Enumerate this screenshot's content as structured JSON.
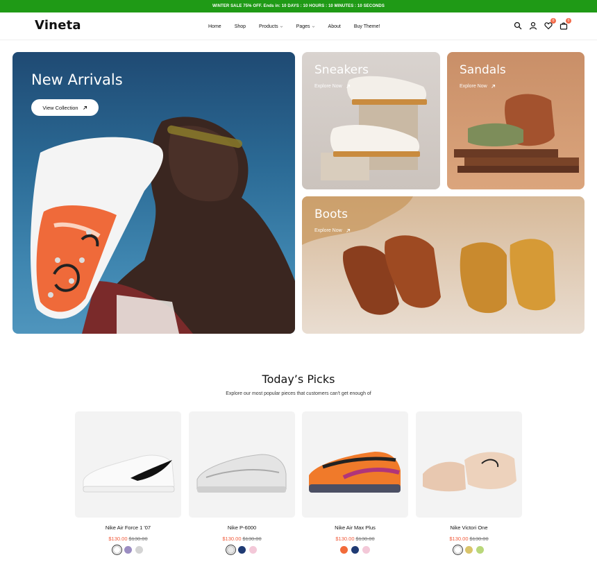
{
  "topbar": {
    "text": "WINTER SALE 75% OFF. Ends in: 10 DAYS : 10 HOURS : 10 MINUTES : 10 SECONDS"
  },
  "brand": {
    "logo": "Vineta"
  },
  "nav": [
    {
      "label": "Home"
    },
    {
      "label": "Shop"
    },
    {
      "label": "Products",
      "has_dropdown": true
    },
    {
      "label": "Pages",
      "has_dropdown": true
    },
    {
      "label": "About"
    },
    {
      "label": "Buy Theme!"
    }
  ],
  "header_icons": {
    "wishlist_count": "0",
    "cart_count": "0"
  },
  "hero": {
    "title": "New Arrivals",
    "button": "View Collection"
  },
  "collections": [
    {
      "title": "Sneakers",
      "cta": "Explore Now"
    },
    {
      "title": "Sandals",
      "cta": "Explore Now"
    },
    {
      "title": "Boots",
      "cta": "Explore Now"
    }
  ],
  "picks": {
    "title": "Today’s Picks",
    "subtitle": "Explore our most popular pieces that customers can't get enough of",
    "products": [
      {
        "name": "Nike Air Force 1 '07",
        "price": "$130.00",
        "compare_price": "$130.00",
        "swatches": [
          "#ffffff",
          "#9b8dc2",
          "#d4d4d4"
        ]
      },
      {
        "name": "Nike P-6000",
        "price": "$130.00",
        "compare_price": "$130.00",
        "swatches": [
          "#e8e8e8",
          "#1f3a73",
          "#f3c8d8"
        ]
      },
      {
        "name": "Nike Air Max Plus",
        "price": "$130.00",
        "compare_price": "$130.00",
        "swatches": [
          "#f26b3a",
          "#1f3a73",
          "#f3c8d8"
        ]
      },
      {
        "name": "Nike Victori One",
        "price": "$130.00",
        "compare_price": "$130.00",
        "swatches": [
          "#ffffff",
          "#d9c46a",
          "#b9d77a"
        ]
      }
    ]
  },
  "colors": {
    "accent_green": "#1f9a16",
    "sale_red": "#f05a3a",
    "badge": "#f26b4a"
  }
}
